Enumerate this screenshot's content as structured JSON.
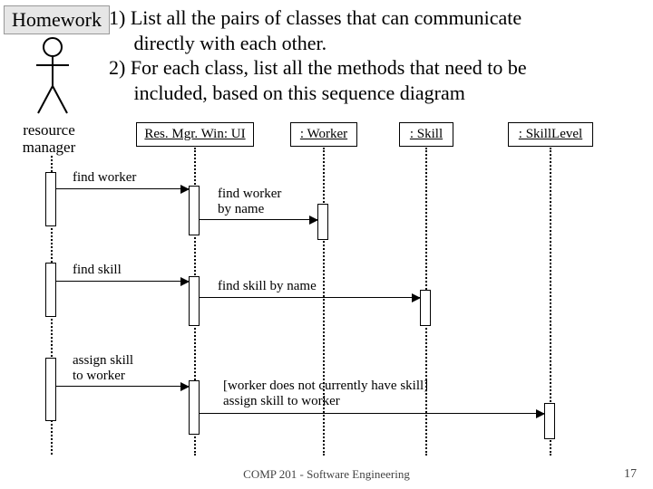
{
  "header": {
    "label": "Homework",
    "prompt_line1": "1) List all the pairs of classes that can communicate",
    "prompt_line1b": "directly with each other.",
    "prompt_line2": "2) For each class, list all the methods that need to be",
    "prompt_line2b": "included, based on this sequence diagram"
  },
  "actor": {
    "label": "resource\nmanager"
  },
  "lifelines": {
    "ui": {
      "label": "Res. Mgr. Win: UI"
    },
    "worker": {
      "label": ": Worker"
    },
    "skill": {
      "label": ": Skill"
    },
    "slevel": {
      "label": ": SkillLevel"
    }
  },
  "messages": {
    "m1": "find worker",
    "m2": "find worker\nby name",
    "m3": "find skill",
    "m4": "find skill by name",
    "m5": "assign skill\nto worker",
    "m6": "[worker does not currently have skill]\nassign skill to worker"
  },
  "footer": {
    "course": "COMP 201 - Software Engineering",
    "page": "17"
  }
}
